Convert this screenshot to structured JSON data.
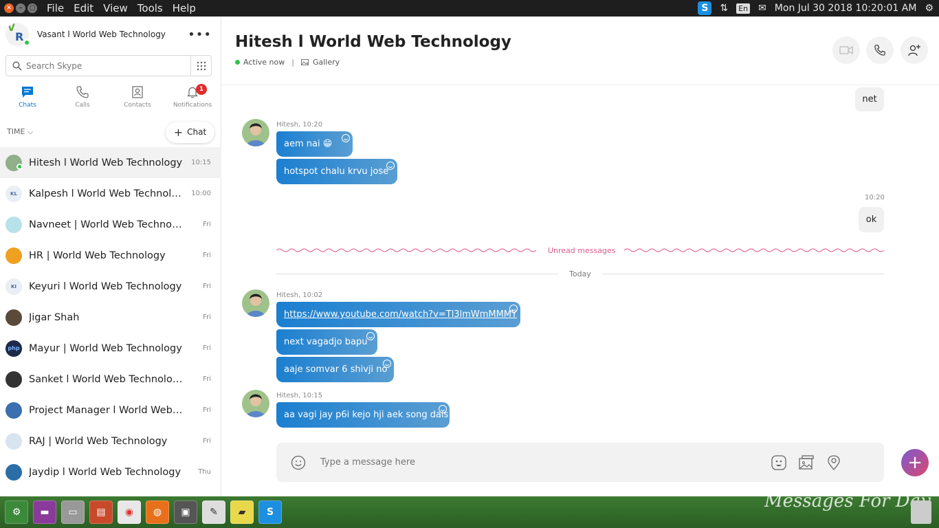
{
  "menubar": {
    "menus": [
      "File",
      "Edit",
      "View",
      "Tools",
      "Help"
    ],
    "lang": "En",
    "clock": "Mon Jul 30 2018 10:20:01 AM"
  },
  "profile": {
    "name": "Vasant l World Web Technology",
    "initials_top": "V",
    "initials_bottom": "R",
    "more": "•••"
  },
  "search": {
    "placeholder": "Search Skype"
  },
  "nav": {
    "tabs": [
      {
        "label": "Chats",
        "icon": "chat-icon"
      },
      {
        "label": "Calls",
        "icon": "phone-icon"
      },
      {
        "label": "Contacts",
        "icon": "contacts-icon"
      },
      {
        "label": "Notifications",
        "icon": "bell-icon"
      }
    ],
    "notification_count": "1"
  },
  "list": {
    "sort_label": "TIME",
    "new_chat_label": "Chat",
    "conversations": [
      {
        "name": "Hitesh l World Web Technology",
        "time": "10:15",
        "selected": true,
        "online": true,
        "avatar_color": "#8fb08a",
        "initials": ""
      },
      {
        "name": "Kalpesh l World Web Technology",
        "time": "10:00",
        "avatar_color": "#eaeef5",
        "initials": "KL"
      },
      {
        "name": "Navneet | World Web Technology",
        "time": "Fri",
        "avatar_color": "#b8e2ea",
        "initials": ""
      },
      {
        "name": "HR | World Web Technology",
        "time": "Fri",
        "avatar_color": "#f0a020",
        "initials": ""
      },
      {
        "name": "Keyuri l World Web Technology",
        "time": "Fri",
        "avatar_color": "#eaeef5",
        "initials": "KI"
      },
      {
        "name": "Jigar Shah",
        "time": "Fri",
        "avatar_color": "#5b4a3a",
        "initials": ""
      },
      {
        "name": "Mayur | World Web Technology",
        "time": "Fri",
        "avatar_color": "#1d2a4a",
        "initials": "php"
      },
      {
        "name": "Sanket l World Web Technology",
        "time": "Fri",
        "avatar_color": "#333333",
        "initials": ""
      },
      {
        "name": "Project Manager l World Web Tech...",
        "time": "Fri",
        "avatar_color": "#3a6fb0",
        "initials": ""
      },
      {
        "name": "RAJ | World Web Technology",
        "time": "Fri",
        "avatar_color": "#d8e4f0",
        "initials": ""
      },
      {
        "name": "Jaydip l World Web Technology",
        "time": "Thu",
        "avatar_color": "#2a6ea8",
        "initials": ""
      }
    ]
  },
  "chat": {
    "title": "Hitesh l World Web Technology",
    "status": "Active now",
    "gallery": "Gallery",
    "outgoing": [
      {
        "text": "net"
      },
      {
        "text": "ok",
        "time": "10:20"
      }
    ],
    "groups": [
      {
        "sender": "Hitesh, 10:20",
        "messages": [
          "aem nai 😁",
          "hotspot chalu krvu jose"
        ]
      },
      {
        "sender": "Hitesh, 10:02",
        "messages": [
          "https://www.youtube.com/watch?v=Tl3lmWmMMMY",
          "next vagadjo bapu",
          "aaje somvar 6 shivji no"
        ]
      },
      {
        "sender": "Hitesh, 10:15",
        "messages": [
          "aa vagi jay p6i kejo hji aek song dais"
        ]
      }
    ],
    "unread_label": "Unread messages",
    "today_label": "Today",
    "compose_placeholder": "Type a message here"
  },
  "taskbar": {
    "wallpaper_text": "Messages For Day"
  },
  "colors": {
    "accent": "#0078d4",
    "bubble_in_start": "#1b7fd0",
    "unread": "#e05a8e",
    "online": "#31c14a"
  }
}
